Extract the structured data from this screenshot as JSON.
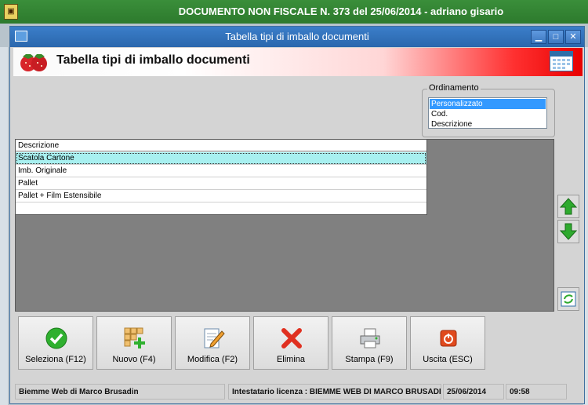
{
  "outer_window": {
    "title": "DOCUMENTO NON FISCALE N. 373 del 25/06/2014 - adriano gisario"
  },
  "dialog": {
    "title": "Tabella tipi di imballo documenti",
    "header_title": "Tabella tipi di imballo documenti"
  },
  "ordering": {
    "label": "Ordinamento",
    "options": [
      "Personalizzato",
      "Cod.",
      "Descrizione"
    ],
    "selected": "Personalizzato"
  },
  "table": {
    "columns": [
      "Descrizione"
    ],
    "rows": [
      "Scatola Cartone",
      "Imb. Originale",
      "Pallet",
      "Pallet + Film Estensibile"
    ],
    "selected_row": 0
  },
  "buttons": {
    "select": "Seleziona (F12)",
    "new": "Nuovo (F4)",
    "edit": "Modifica (F2)",
    "delete": "Elimina",
    "print": "Stampa (F9)",
    "exit": "Uscita (ESC)"
  },
  "status": {
    "company": "Biemme Web di Marco Brusadin",
    "license": "Intestatario licenza : BIEMME WEB DI MARCO BRUSADIN",
    "date": "25/06/2014",
    "time": "09:58"
  },
  "colors": {
    "outer_titlebar": "#2d7a2d",
    "dialog_titlebar": "#2a67ad",
    "header_gradient_end": "#e80000",
    "selected_row": "#a8f0f0",
    "selected_option": "#3399ff"
  },
  "icons": [
    "app-icon",
    "window-icon",
    "minimize-icon",
    "maximize-icon",
    "close-icon",
    "strawberry-icon",
    "calendar-icon",
    "arrow-up-icon",
    "arrow-down-icon",
    "refresh-icon",
    "check-icon",
    "new-grid-icon",
    "edit-icon",
    "delete-x-icon",
    "printer-icon",
    "power-icon"
  ]
}
